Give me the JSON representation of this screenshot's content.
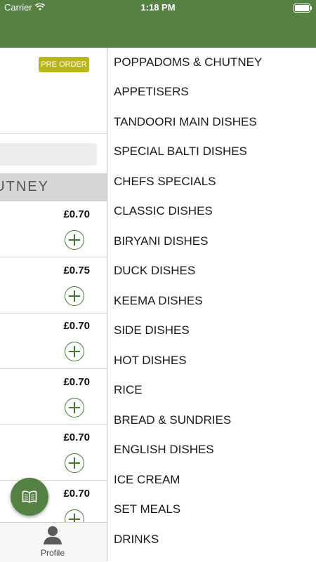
{
  "status_bar": {
    "carrier": "Carrier",
    "time": "1:18 PM"
  },
  "badge": {
    "label": "PRE ORDER",
    "color": "#b9b51c"
  },
  "category": {
    "label": "UTNEY"
  },
  "items": [
    {
      "price": "£0.70"
    },
    {
      "price": "£0.75"
    },
    {
      "price": "£0.70"
    },
    {
      "price": "£0.70"
    },
    {
      "price": "£0.70"
    },
    {
      "price": "£0.70"
    }
  ],
  "tabbar": {
    "profile_label": "Profile"
  },
  "menu": [
    "POPPADOMS & CHUTNEY",
    "APPETISERS",
    "TANDOORI MAIN DISHES",
    "SPECIAL BALTI DISHES",
    "CHEFS SPECIALS",
    "CLASSIC DISHES",
    "BIRYANI DISHES",
    "DUCK DISHES",
    "KEEMA DISHES",
    "SIDE DISHES",
    "HOT DISHES",
    "RICE",
    "BREAD & SUNDRIES",
    "ENGLISH DISHES",
    "ICE CREAM",
    "SET MEALS",
    "DRINKS"
  ],
  "colors": {
    "header_green": "#558143",
    "add_green": "#3f7a2c"
  },
  "icons": {
    "wifi": "wifi-icon",
    "battery": "battery-icon",
    "add": "add-circle-icon",
    "menu_book": "menu-book-icon",
    "profile": "person-icon"
  }
}
